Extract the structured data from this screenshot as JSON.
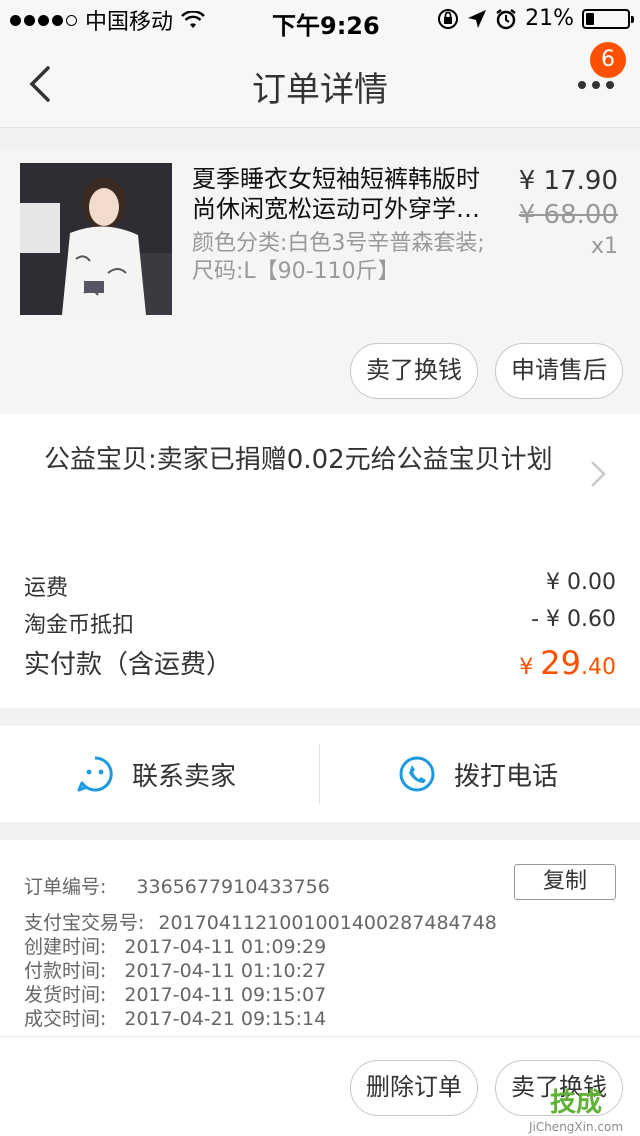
{
  "status_bar": {
    "carrier": "中国移动",
    "time": "下午9:26",
    "battery_percent": "21%",
    "battery_level": 0.21
  },
  "nav": {
    "title": "订单详情",
    "badge_count": "6",
    "back_icon": "chevron-left-icon",
    "more_icon": "more-icon"
  },
  "product": {
    "title": "夏季睡衣女短袖短裤韩版时尚休闲宽松运动可外穿学…",
    "sku": "颜色分类:白色3号辛普森套装;尺码:L【90-110斤】",
    "price": "¥ 17.90",
    "original_price": "¥ 68.00",
    "quantity": "x1",
    "buttons": [
      "卖了换钱",
      "申请售后"
    ]
  },
  "charity": {
    "text": "公益宝贝:卖家已捐赠0.02元给公益宝贝计划"
  },
  "fees": {
    "rows": [
      {
        "label": "运费",
        "value": "¥ 0.00"
      },
      {
        "label": "淘金币抵扣",
        "value": "- ¥ 0.60"
      }
    ],
    "total_label": "实付款（含运费）",
    "total_currency": "¥ ",
    "total_integer": "29",
    "total_decimal": ".40",
    "accent_color": "#ff5000"
  },
  "contact": {
    "seller": "联系卖家",
    "phone": "拨打电话",
    "seller_icon": "chat-bubble-icon",
    "phone_icon": "phone-icon",
    "icon_color": "#1e9ae0"
  },
  "order_info": {
    "order_no_label": "订单编号:",
    "order_no": "3365677910433756",
    "copy_label": "复制",
    "rows": [
      {
        "label": "支付宝交易号:",
        "value": "2017041121001001400287484748"
      },
      {
        "label": "创建时间:",
        "value": "2017-04-11 01:09:29"
      },
      {
        "label": "付款时间:",
        "value": "2017-04-11 01:10:27"
      },
      {
        "label": "发货时间:",
        "value": "2017-04-11 09:15:07"
      },
      {
        "label": "成交时间:",
        "value": "2017-04-21 09:15:14"
      }
    ]
  },
  "footer": {
    "buttons": [
      "删除订单",
      "卖了换钱"
    ]
  },
  "watermark": {
    "logo": "技成",
    "url": "JiChengXin.com"
  }
}
